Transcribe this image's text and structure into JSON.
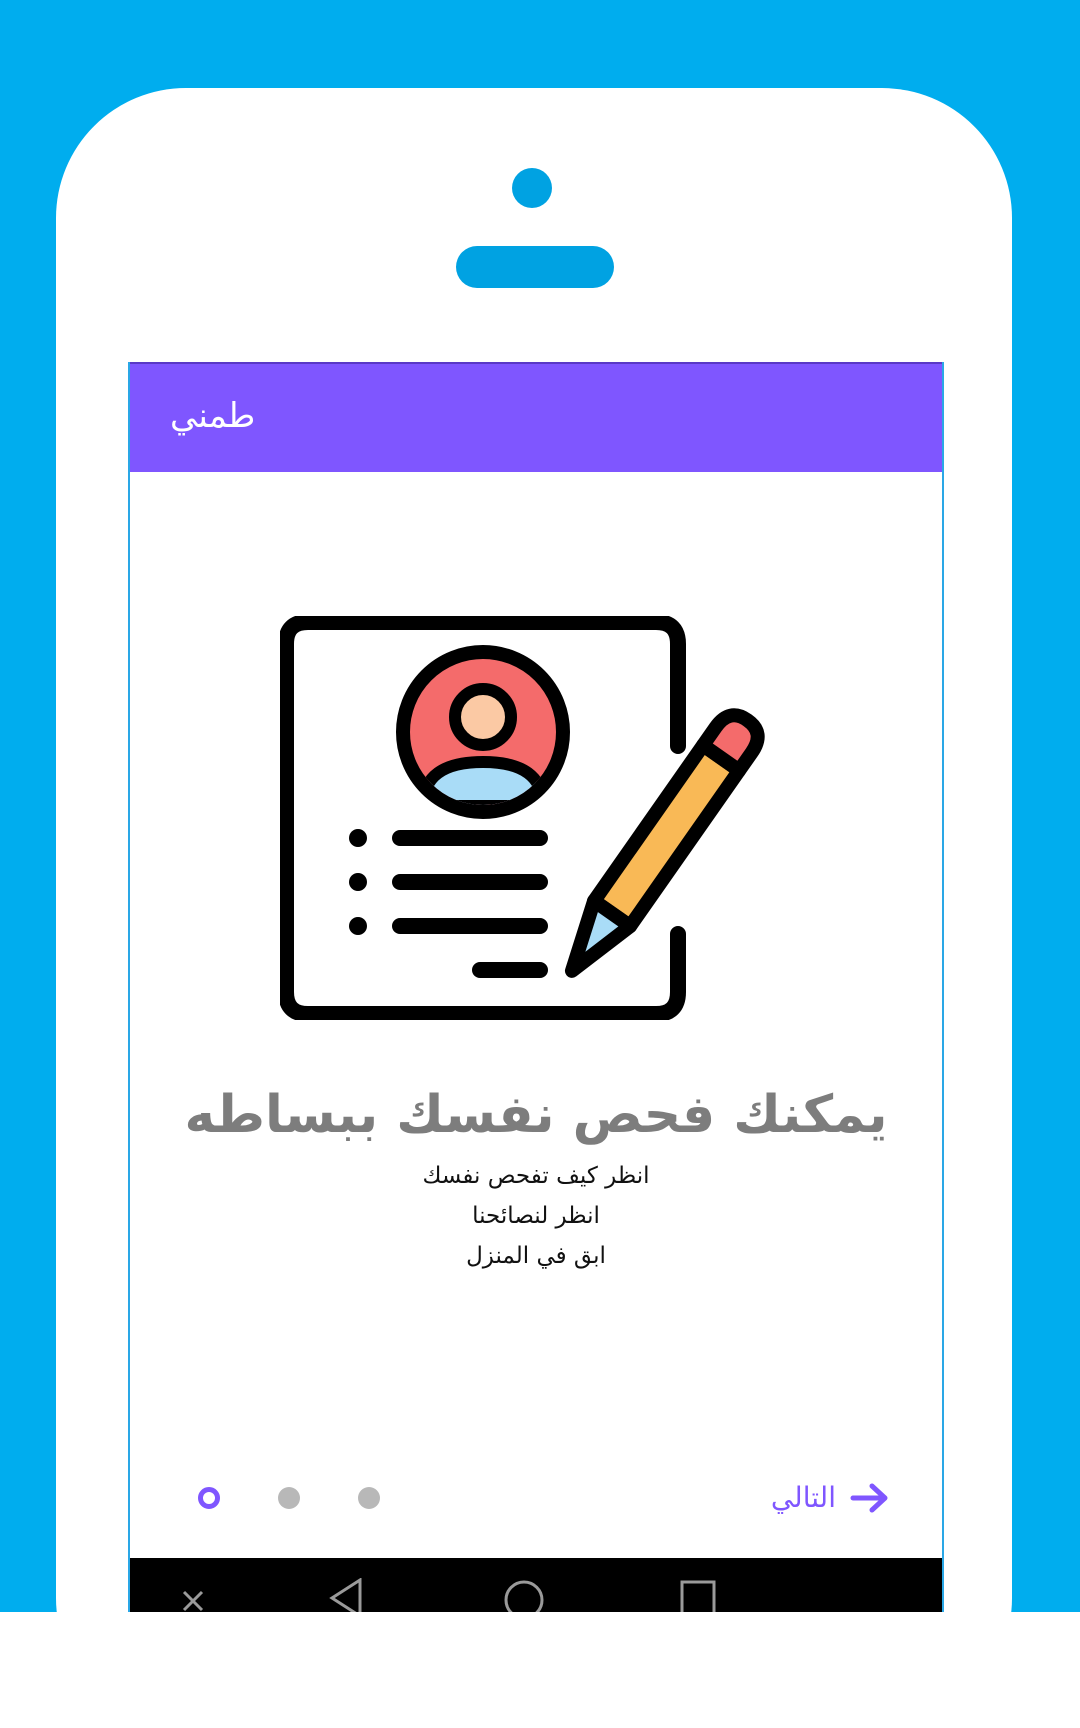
{
  "app": {
    "title": "طمني"
  },
  "onboarding": {
    "headline": "يمكنك فحص نفسك ببساطه",
    "lines": [
      "انظر كيف تفحص نفسك",
      "انظر لنصائحنا",
      "ابق في المنزل"
    ],
    "illustration_icon": "document-profile-pencil-icon",
    "page_indicator": {
      "total": 3,
      "current": 1
    },
    "next_label": "التالي",
    "next_icon": "arrow-right-icon"
  },
  "nav_bar": {
    "icons": [
      "close-icon",
      "back-icon",
      "home-icon",
      "recents-icon"
    ]
  },
  "colors": {
    "background": "#00adee",
    "phone_accent": "#00a2e2",
    "app_bar": "#7f56ff",
    "headline": "#7d7d7d",
    "inactive_dot": "#b8b8b8",
    "avatar_red": "#f46b6b",
    "avatar_face": "#fbc9a4",
    "avatar_body": "#a9dcf7",
    "pencil_body": "#f9b956",
    "pencil_tip": "#a9dcf7",
    "pencil_eraser": "#f46b6b"
  }
}
